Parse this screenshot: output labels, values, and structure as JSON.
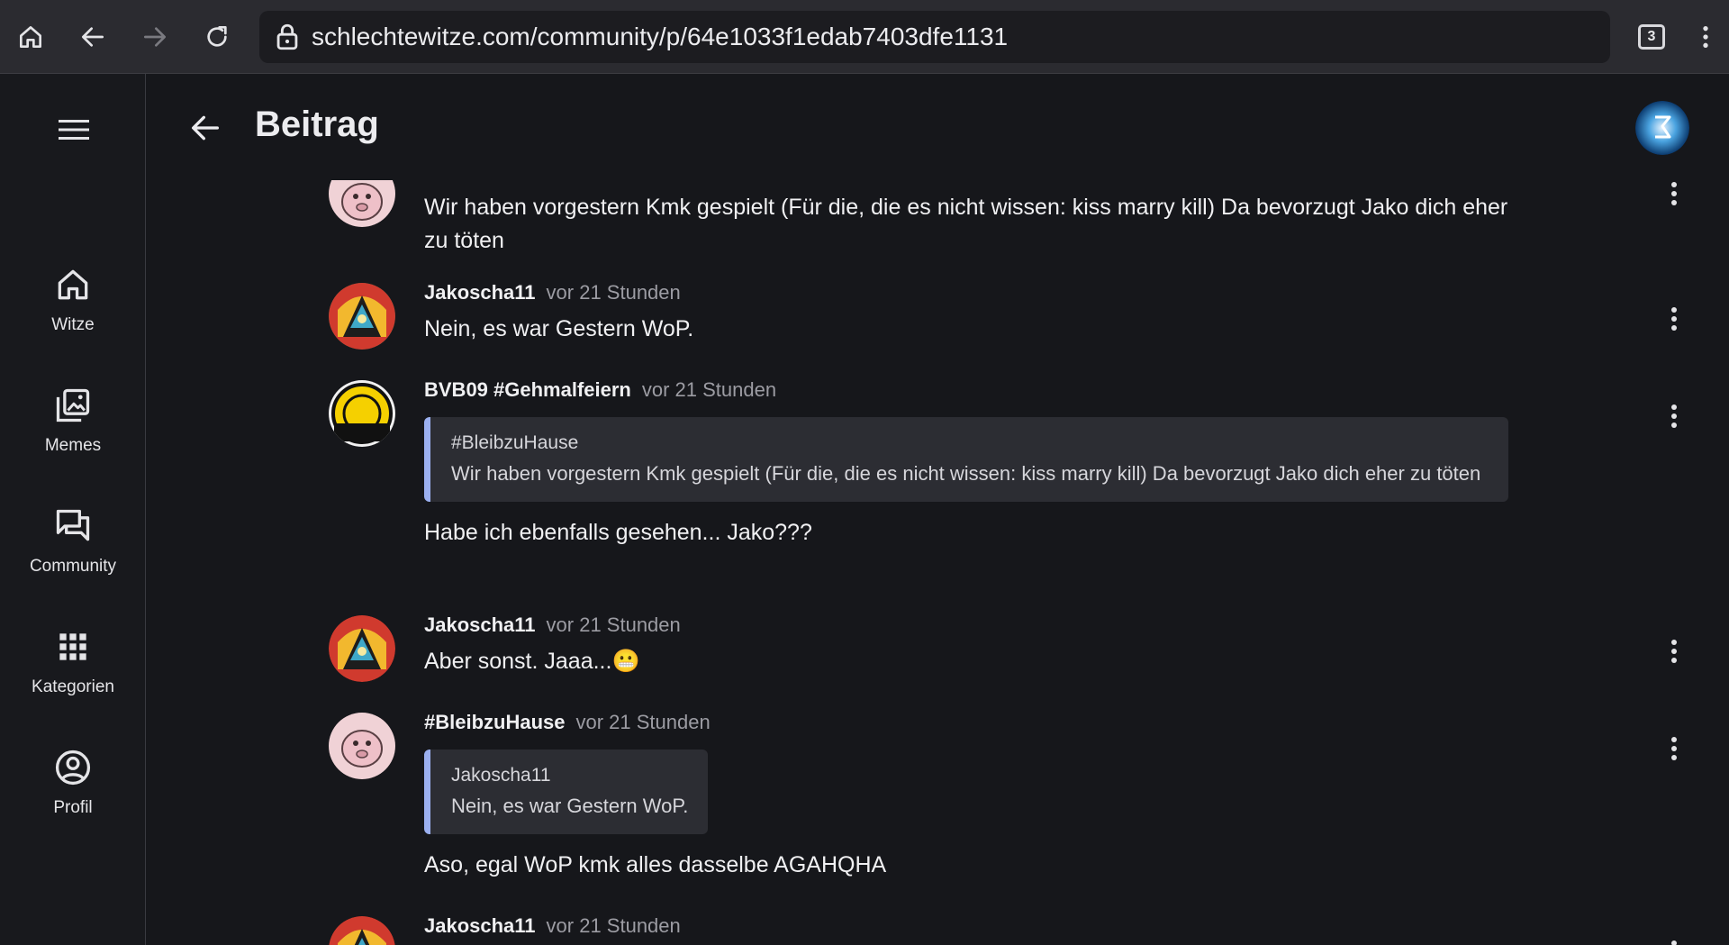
{
  "browser": {
    "url": "schlechtewitze.com/community/p/64e1033f1edab7403dfe1131",
    "tabs_count": "3"
  },
  "sidebar": {
    "items": [
      {
        "label": "Witze",
        "icon": "home-icon"
      },
      {
        "label": "Memes",
        "icon": "images-icon"
      },
      {
        "label": "Community",
        "icon": "forum-icon"
      },
      {
        "label": "Kategorien",
        "icon": "apps-grid-icon"
      },
      {
        "label": "Profil",
        "icon": "account-circle-icon"
      }
    ]
  },
  "header": {
    "title": "Beitrag"
  },
  "comments": [
    {
      "text": "Wir haben vorgestern Kmk gespielt (Für die, die es nicht wissen: kiss marry kill) Da bevorzugt Jako dich eher zu töten"
    },
    {
      "author": "Jakoscha11",
      "time": "vor 21 Stunden",
      "text": "Nein, es war Gestern WoP."
    },
    {
      "author": "BVB09 #Gehmalfeiern",
      "time": "vor 21 Stunden",
      "quote_author": "#BleibzuHause",
      "quote_text": "Wir haben vorgestern Kmk gespielt (Für die, die es nicht wissen: kiss marry kill) Da bevorzugt Jako dich eher zu töten",
      "text": "Habe ich ebenfalls gesehen... Jako???"
    },
    {
      "author": "Jakoscha11",
      "time": "vor 21 Stunden",
      "text": "Aber sonst. Jaaa...😬"
    },
    {
      "author": "#BleibzuHause",
      "time": "vor 21 Stunden",
      "quote_author": "Jakoscha11",
      "quote_text": "Nein, es war Gestern WoP.",
      "text": "Aso, egal WoP kmk alles dasselbe AGAHQHA"
    },
    {
      "author": "Jakoscha11",
      "time": "vor 21 Stunden"
    }
  ],
  "colors": {
    "background": "#16171b",
    "quote_accent": "#9bb0f0",
    "quote_bg": "#2c2d33",
    "muted_text": "#9c9ca3"
  }
}
